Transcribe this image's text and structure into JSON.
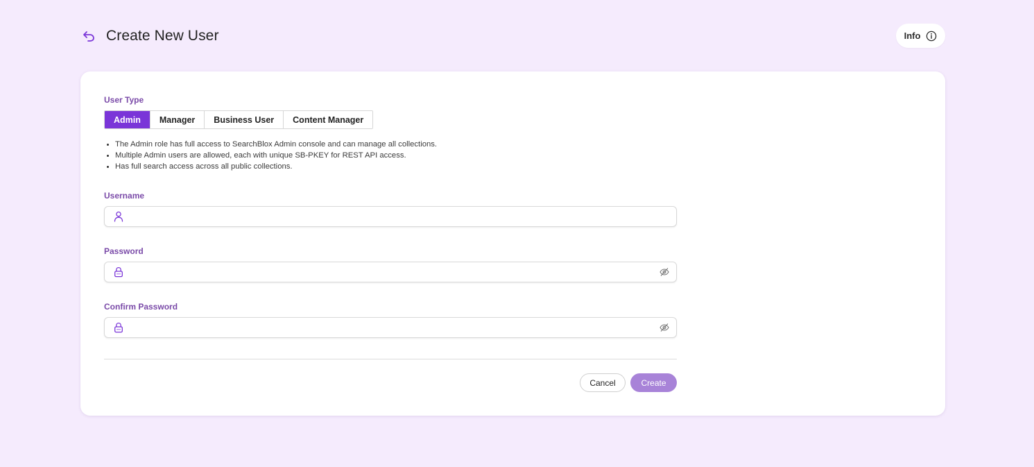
{
  "header": {
    "title": "Create New User",
    "info_label": "Info"
  },
  "user_type": {
    "label": "User Type",
    "tabs": [
      {
        "label": "Admin",
        "active": true
      },
      {
        "label": "Manager",
        "active": false
      },
      {
        "label": "Business User",
        "active": false
      },
      {
        "label": "Content Manager",
        "active": false
      }
    ],
    "descriptions": [
      "The Admin role has full access to SearchBlox Admin console and can manage all collections.",
      "Multiple Admin users are allowed, each with unique SB-PKEY for REST API access.",
      "Has full search access across all public collections."
    ]
  },
  "form": {
    "username": {
      "label": "Username",
      "value": ""
    },
    "password": {
      "label": "Password",
      "value": ""
    },
    "confirm_password": {
      "label": "Confirm Password",
      "value": ""
    }
  },
  "actions": {
    "cancel_label": "Cancel",
    "create_label": "Create"
  },
  "colors": {
    "accent": "#7a35d8",
    "label": "#7a4aa8",
    "create_button": "#a883d8",
    "background": "#f5ebfd"
  }
}
